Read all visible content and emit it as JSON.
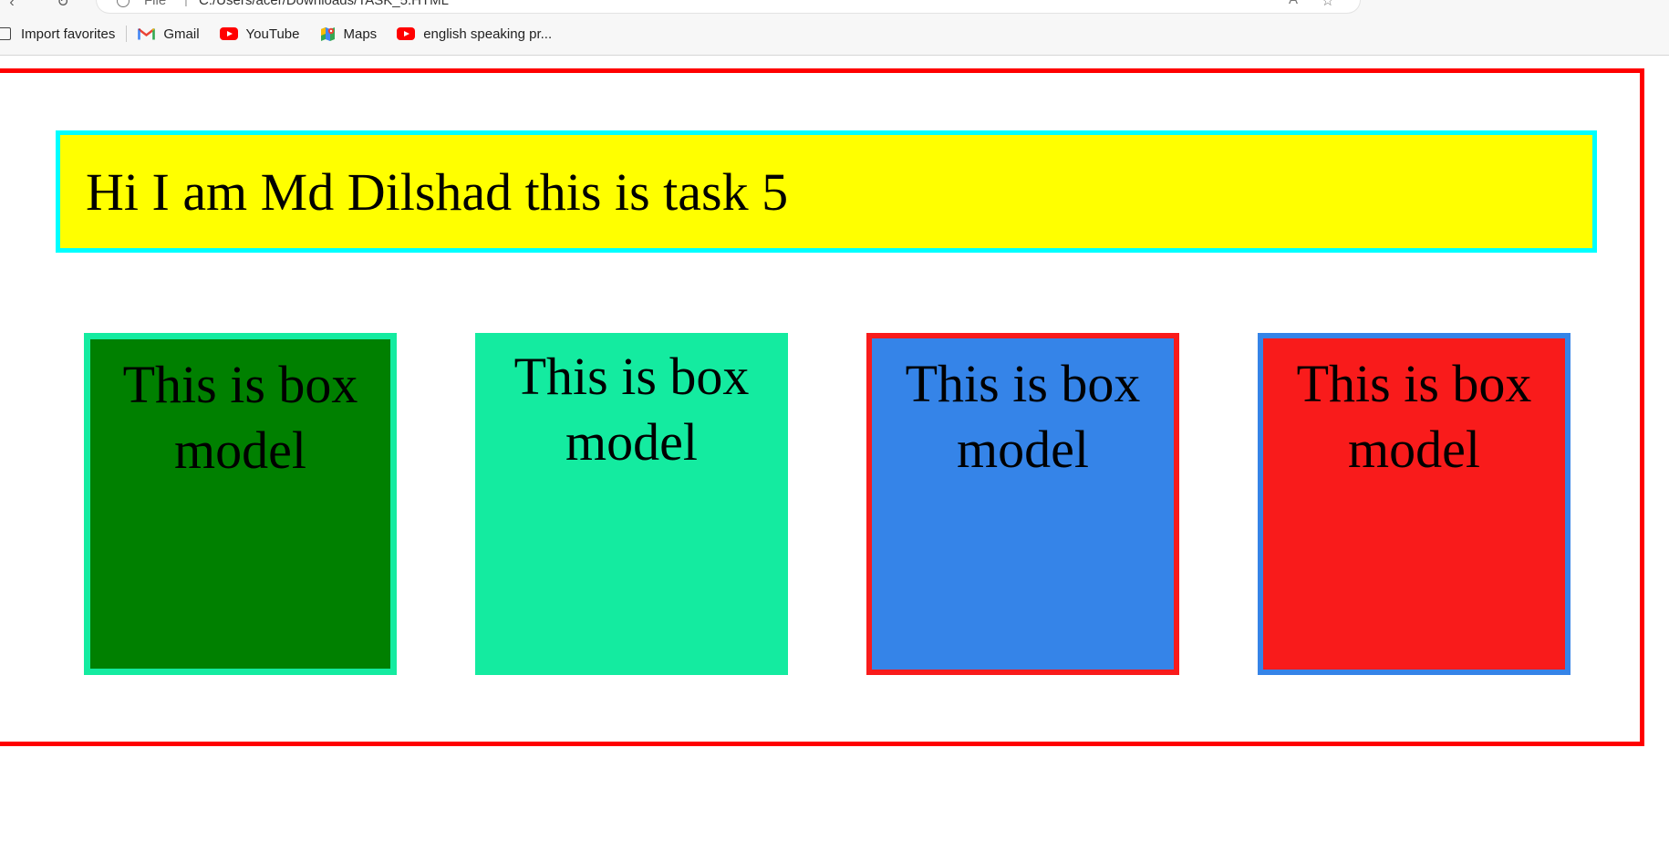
{
  "browser": {
    "address": {
      "scheme_label": "File",
      "separator": "|",
      "url": "C:/Users/acer/Downloads/TASK_5.HTML"
    },
    "bookmarks": [
      {
        "label": "Import favorites",
        "icon": "import-icon"
      },
      {
        "label": "Gmail",
        "icon": "gmail-icon"
      },
      {
        "label": "YouTube",
        "icon": "youtube-icon"
      },
      {
        "label": "Maps",
        "icon": "maps-icon"
      },
      {
        "label": "english speaking pr...",
        "icon": "youtube-icon"
      }
    ]
  },
  "page": {
    "heading": "Hi I am Md Dilshad this is task 5",
    "boxes": [
      {
        "text": "This is box model"
      },
      {
        "text": "This is box model"
      },
      {
        "text": "This is box model"
      },
      {
        "text": "This is box model"
      }
    ]
  },
  "colors": {
    "outer_border": "#ff0000",
    "heading_bg": "#ffff00",
    "heading_border": "#00ffff",
    "box1_bg": "#008000",
    "box1_border": "#14eba0",
    "box2_bg": "#14eba0",
    "box3_bg": "#3584e8",
    "box3_border": "#f91b1b",
    "box4_bg": "#f91b1b",
    "box4_border": "#3584e8"
  }
}
